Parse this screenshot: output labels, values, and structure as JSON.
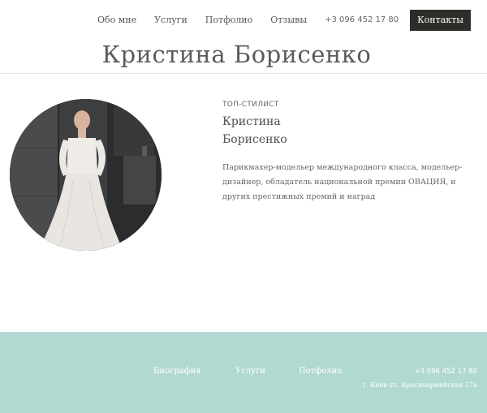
{
  "header": {
    "nav": [
      {
        "label": "Обо мне"
      },
      {
        "label": "Услуги"
      },
      {
        "label": "Потфолио"
      },
      {
        "label": "Отзывы"
      }
    ],
    "phone": "+3 096 452 17 80",
    "cta_label": "Контакты",
    "cta_color": "#2f2d2a"
  },
  "page_title": "Кристина Борисенко",
  "profile": {
    "role": "ТОП-СТИЛИСТ",
    "name_line1": "Кристина",
    "name_line2": "Борисенко",
    "description": "Парикмахер-модельер международного класса, модельер-дизайнер, обладатель национальной премии ОВАЦИЯ, и других престижных премий и наград",
    "photo_icon": "bride-portrait-image"
  },
  "footer": {
    "background": "#b1d9d1",
    "links": [
      {
        "label": "Биография"
      },
      {
        "label": "Услуги"
      },
      {
        "label": "Потфолио"
      }
    ],
    "phone": "+3 096 452 17 80",
    "address": "г. Киев ул. Красноармейская 17а"
  }
}
